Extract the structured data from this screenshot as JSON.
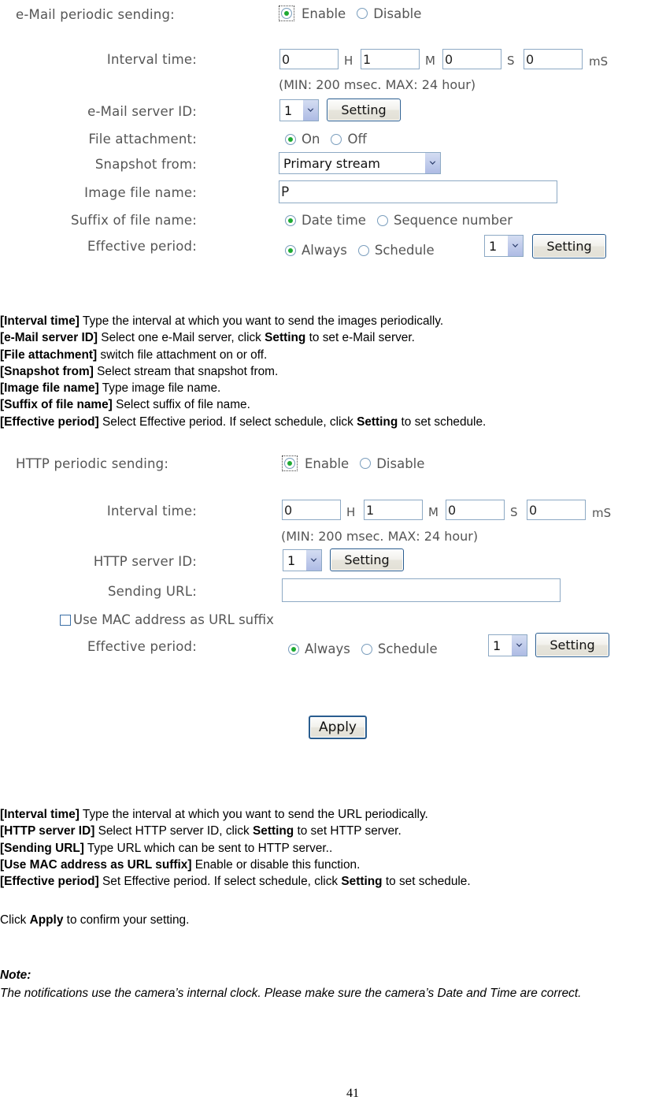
{
  "email_form": {
    "title_label": "e-Mail periodic sending:",
    "enable_label": "Enable",
    "disable_label": "Disable",
    "enable_selected": true,
    "interval_label": "Interval time:",
    "interval": {
      "hours": "0",
      "hours_unit": "H",
      "minutes": "1",
      "minutes_unit": "M",
      "seconds": "0",
      "seconds_unit": "S",
      "milliseconds": "0",
      "milliseconds_unit": "mS"
    },
    "interval_hint": "(MIN: 200 msec. MAX: 24 hour)",
    "server_id_label": "e-Mail server ID:",
    "server_id_value": "1",
    "server_id_setting_button": "Setting",
    "file_attachment_label": "File attachment:",
    "file_attachment_on": "On",
    "file_attachment_off": "Off",
    "file_attachment_selected": "On",
    "snapshot_from_label": "Snapshot from:",
    "snapshot_from_value": "Primary stream",
    "image_file_name_label": "Image file name:",
    "image_file_name_value": "P",
    "suffix_label": "Suffix of file name:",
    "suffix_date_time": "Date time",
    "suffix_sequence_number": "Sequence number",
    "suffix_selected": "Date time",
    "effective_period_label": "Effective period:",
    "effective_always": "Always",
    "effective_schedule": "Schedule",
    "effective_selected": "Always",
    "schedule_id_value": "1",
    "effective_setting_button": "Setting"
  },
  "email_desc": [
    {
      "term": "[Interval time]",
      "rest": " Type the interval at which you want to send the images periodically."
    },
    {
      "term": "[e-Mail server ID]",
      "rest": " Select one e-Mail server, click ",
      "bold2": "Setting",
      "rest2": " to set e-Mail server."
    },
    {
      "term": "[File attachment]",
      "rest": " switch file attachment on or off."
    },
    {
      "term": "[Snapshot from]",
      "rest": " Select stream that snapshot from."
    },
    {
      "term": "[Image file name]",
      "rest": " Type image file name."
    },
    {
      "term": "[Suffix of file name]",
      "rest": " Select suffix of file name."
    },
    {
      "term": "[Effective period]",
      "rest": " Select Effective period. If select schedule, click ",
      "bold2": "Setting",
      "rest2": " to set schedule."
    }
  ],
  "http_form": {
    "title_label": "HTTP periodic sending:",
    "enable_label": "Enable",
    "disable_label": "Disable",
    "enable_selected": true,
    "interval_label": "Interval time:",
    "interval": {
      "hours": "0",
      "hours_unit": "H",
      "minutes": "1",
      "minutes_unit": "M",
      "seconds": "0",
      "seconds_unit": "S",
      "milliseconds": "0",
      "milliseconds_unit": "mS"
    },
    "interval_hint": "(MIN: 200 msec. MAX: 24 hour)",
    "server_id_label": "HTTP server ID:",
    "server_id_value": "1",
    "server_id_setting_button": "Setting",
    "sending_url_label": "Sending URL:",
    "sending_url_value": "",
    "use_mac_label": "Use MAC address as URL suffix",
    "use_mac_checked": false,
    "effective_period_label": "Effective period:",
    "effective_always": "Always",
    "effective_schedule": "Schedule",
    "effective_selected": "Always",
    "schedule_id_value": "1",
    "effective_setting_button": "Setting"
  },
  "apply_button": "Apply",
  "http_desc": [
    {
      "term": "[Interval time]",
      "rest": " Type the interval at which you want to send the URL periodically."
    },
    {
      "term": "[HTTP server ID]",
      "rest": " Select HTTP server ID, click ",
      "bold2": "Setting",
      "rest2": " to set HTTP server."
    },
    {
      "term": "[Sending URL]",
      "rest": " Type URL which can be sent to HTTP server.."
    },
    {
      "term": "[Use MAC address as URL suffix]",
      "rest": " Enable or disable this function."
    },
    {
      "term": "[Effective period]",
      "rest": " Set Effective period. If select schedule, click ",
      "bold2": "Setting",
      "rest2": " to set schedule."
    }
  ],
  "apply_sentence": {
    "pre": "Click ",
    "bold": "Apply",
    "post": " to confirm your setting."
  },
  "note": {
    "title": "Note:",
    "body": "The notifications use the camera’s internal clock. Please make sure the camera’s Date and Time are correct."
  },
  "page_number": "41",
  "colors": {
    "label_gray": "#555555",
    "input_border": "#8da9c4",
    "button_border": "#2a5d8f",
    "radio_dot_green": "#1faa34",
    "select_arrow": "#aebbe4"
  }
}
